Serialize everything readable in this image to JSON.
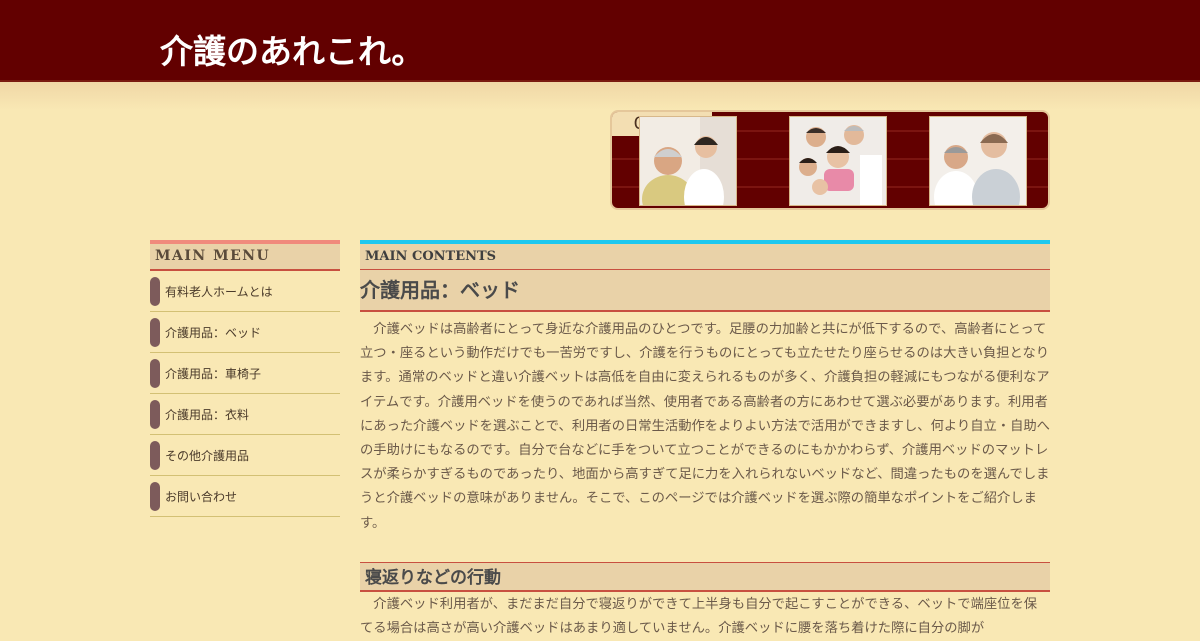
{
  "header": {
    "site_title": "介護のあれこれ。"
  },
  "banner": {
    "care_label": "Care",
    "photos": [
      "elderly-man-caregiver-photo",
      "family-photo",
      "elderly-couple-photo"
    ]
  },
  "sidebar": {
    "heading": "MAIN MENU",
    "items": [
      {
        "label": "有料老人ホームとは"
      },
      {
        "label": "介護用品：ベッド"
      },
      {
        "label": "介護用品：車椅子"
      },
      {
        "label": "介護用品：衣料"
      },
      {
        "label": "その他介護用品"
      },
      {
        "label": "お問い合わせ"
      }
    ]
  },
  "main": {
    "heading": "MAIN CONTENTS",
    "page_title": "介護用品：ベッド",
    "intro": "介護ベッドは高齢者にとって身近な介護用品のひとつです。足腰の力加齢と共にが低下するので、高齢者にとって立つ・座るという動作だけでも一苦労ですし、介護を行うものにとっても立たせたり座らせるのは大きい負担となります。通常のベッドと違い介護ベットは高低を自由に変えられるものが多く、介護負担の軽減にもつながる便利なアイテムです。介護用ベッドを使うのであれば当然、使用者である高齢者の方にあわせて選ぶ必要があります。利用者にあった介護ベッドを選ぶことで、利用者の日常生活動作をよりよい方法で活用ができますし、何より自立・自助への手助けにもなるのです。自分で台などに手をついて立つことができるのにもかかわらず、介護用ベッドのマットレスが柔らかすぎるものであったり、地面から高すぎて足に力を入れられないベッドなど、間違ったものを選んでしまうと介護ベッドの意味がありません。そこで、このページでは介護ベッドを選ぶ際の簡単なポイントをご紹介します。",
    "section_title": "寝返りなどの行動",
    "section_text": "介護ベッド利用者が、まだまだ自分で寝返りができて上半身も自分で起こすことができる、ベットで端座位を保てる場合は高さが高い介護ベッドはあまり適していません。介護ベッドに腰を落ち着けた際に自分の脚が"
  },
  "colors": {
    "header_bg": "#620000",
    "page_bg": "#f9e8b4",
    "menu_accent": "#f08a7c",
    "main_accent": "#1ec8f0",
    "rule": "#c85040",
    "menu_bar": "#7d5b5b"
  }
}
